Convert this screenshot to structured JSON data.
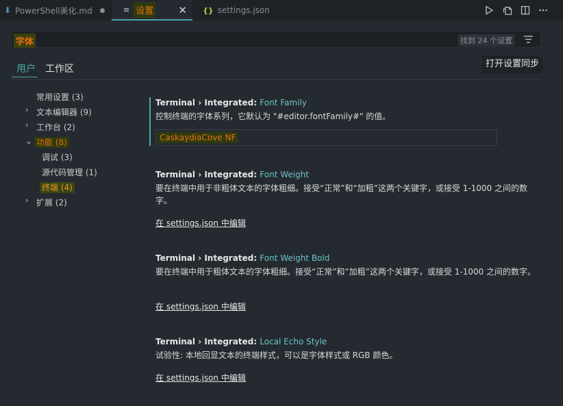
{
  "tabs": [
    {
      "label": "PowerShell美化.md",
      "icon": "arrow-down-icon"
    },
    {
      "label": "设置",
      "icon": "settings-list-icon"
    },
    {
      "label": "settings.json",
      "icon": "json-braces-icon"
    }
  ],
  "tab_icons": {
    "md": "⬇",
    "settings": "≡",
    "json": "{}",
    "close": "✕"
  },
  "search": {
    "value": "字体",
    "result_count": "找到 24 个设置"
  },
  "scopes": {
    "user": "用户",
    "workspace": "工作区"
  },
  "sync_button": "打开设置同步",
  "toc": [
    {
      "label": "常用设置 (3)"
    },
    {
      "label": "文本编辑器 (9)"
    },
    {
      "label": "工作台 (2)"
    },
    {
      "label": "功能 (8)"
    },
    {
      "label": "调试 (3)"
    },
    {
      "label": "源代码管理 (1)"
    },
    {
      "label": "终端 (4)"
    },
    {
      "label": "扩展 (2)"
    }
  ],
  "settings": [
    {
      "prefix": "Terminal › Integrated: ",
      "key": "Font Family",
      "description": "控制终端的字体系列，它默认为 \"#editor.fontFamily#\" 的值。",
      "value": "CaskaydiaCove NF"
    },
    {
      "prefix": "Terminal › Integrated: ",
      "key": "Font Weight",
      "description": "要在终端中用于非粗体文本的字体粗细。接受“正常”和“加粗”这两个关键字，或接受 1-1000 之间的数字。",
      "edit_link": "在 settings.json 中编辑"
    },
    {
      "prefix": "Terminal › Integrated: ",
      "key": "Font Weight Bold",
      "description": "要在终端中用于粗体文本的字体粗细。接受“正常”和“加粗”这两个关键字，或接受 1-1000 之间的数字。",
      "edit_link": "在 settings.json 中编辑"
    },
    {
      "prefix": "Terminal › Integrated: ",
      "key": "Local Echo Style",
      "description": "试验性: 本地回显文本的终端样式，可以是字体样式或 RGB 颜色。",
      "edit_link": "在 settings.json 中编辑"
    }
  ],
  "colors": {
    "accent": "#4aa6a8",
    "highlight": "#e8700f",
    "background": "#252a30"
  }
}
